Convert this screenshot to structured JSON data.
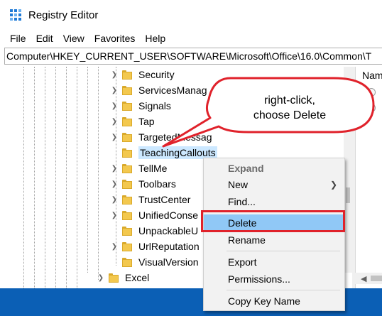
{
  "window": {
    "title": "Registry Editor",
    "icon": "registry-icon"
  },
  "menu": [
    "File",
    "Edit",
    "View",
    "Favorites",
    "Help"
  ],
  "address": "Computer\\HKEY_CURRENT_USER\\SOFTWARE\\Microsoft\\Office\\16.0\\Common\\T",
  "tree": {
    "rows": [
      {
        "label": "Security",
        "expander": "collapsed"
      },
      {
        "label": "ServicesManag",
        "expander": "collapsed"
      },
      {
        "label": "Signals",
        "expander": "collapsed"
      },
      {
        "label": "Tap",
        "expander": "collapsed"
      },
      {
        "label": "TargetedMessag",
        "expander": "collapsed"
      },
      {
        "label": "TeachingCallouts",
        "expander": "none",
        "selected": true
      },
      {
        "label": "TellMe",
        "expander": "collapsed"
      },
      {
        "label": "Toolbars",
        "expander": "collapsed"
      },
      {
        "label": "TrustCenter",
        "expander": "collapsed"
      },
      {
        "label": "UnifiedConse",
        "expander": "collapsed"
      },
      {
        "label": "UnpackableU",
        "expander": "none"
      },
      {
        "label": "UrlReputation",
        "expander": "collapsed"
      },
      {
        "label": "VisualVersion",
        "expander": "none"
      },
      {
        "label": "Excel",
        "expander": "collapsed"
      }
    ]
  },
  "right_pane": {
    "header": "Nam"
  },
  "context_menu": {
    "items": {
      "expand": "Expand",
      "new": "New",
      "find": "Find...",
      "delete": "Delete",
      "rename": "Rename",
      "export": "Export",
      "permissions": "Permissions...",
      "copy_key_name": "Copy Key Name"
    }
  },
  "callout": {
    "line1": "right-click,",
    "line2": "choose Delete"
  },
  "colors": {
    "selection": "#cce8ff",
    "menu_highlight": "#90c8f6",
    "annotation_red": "#e0222b",
    "folder_yellow": "#f3c84e",
    "desktop_blue": "#0b5fb5"
  }
}
